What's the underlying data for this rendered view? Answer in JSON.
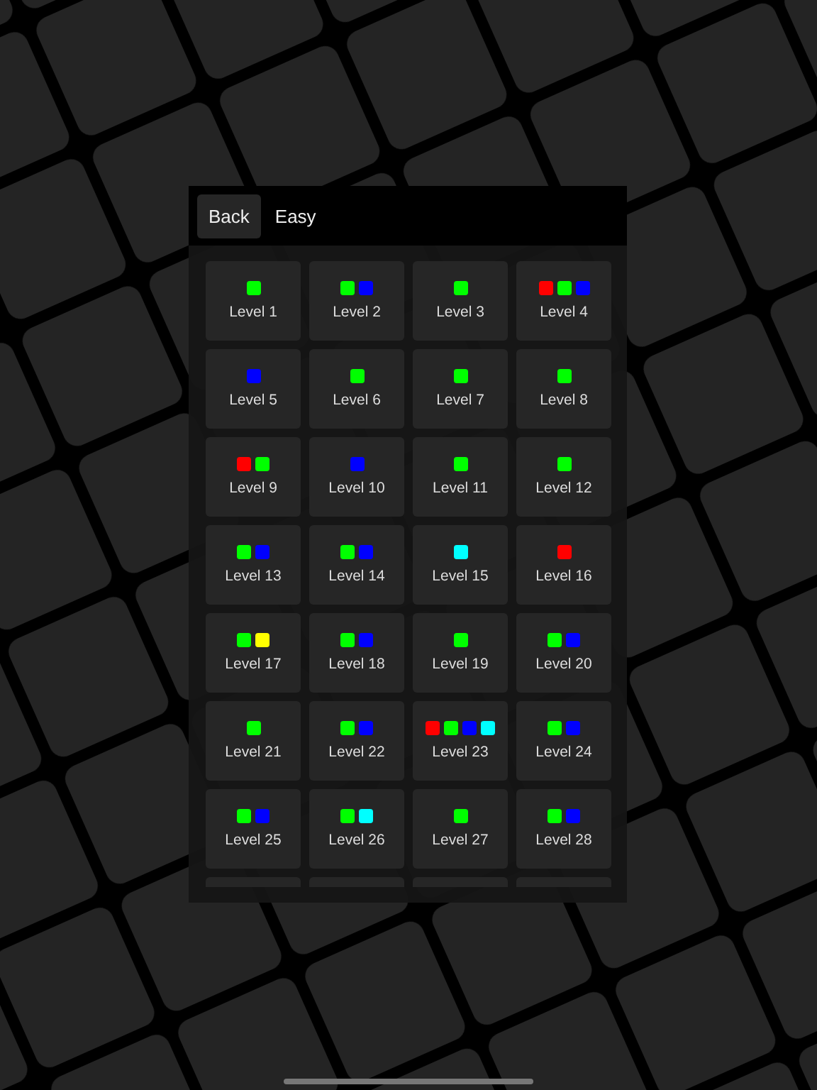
{
  "header": {
    "back_button": "Back",
    "title": "Easy"
  },
  "levels": [
    {
      "label": "Level 1",
      "dots": [
        {
          "color": "#00ff00"
        }
      ]
    },
    {
      "label": "Level 2",
      "dots": [
        {
          "color": "#00ff00"
        },
        {
          "color": "#0000ff"
        }
      ]
    },
    {
      "label": "Level 3",
      "dots": [
        {
          "color": "#00ff00"
        }
      ]
    },
    {
      "label": "Level 4",
      "dots": [
        {
          "color": "#ff0000"
        },
        {
          "color": "#00ff00"
        },
        {
          "color": "#0000ff"
        }
      ]
    },
    {
      "label": "Level 5",
      "dots": [
        {
          "color": "#0000ff"
        }
      ]
    },
    {
      "label": "Level 6",
      "dots": [
        {
          "color": "#00ff00"
        }
      ]
    },
    {
      "label": "Level 7",
      "dots": [
        {
          "color": "#00ff00"
        }
      ]
    },
    {
      "label": "Level 8",
      "dots": [
        {
          "color": "#00ff00"
        }
      ]
    },
    {
      "label": "Level 9",
      "dots": [
        {
          "color": "#ff0000"
        },
        {
          "color": "#00ff00"
        }
      ]
    },
    {
      "label": "Level 10",
      "dots": [
        {
          "color": "#0000ff"
        }
      ]
    },
    {
      "label": "Level 11",
      "dots": [
        {
          "color": "#00ff00"
        }
      ]
    },
    {
      "label": "Level 12",
      "dots": [
        {
          "color": "#00ff00"
        }
      ]
    },
    {
      "label": "Level 13",
      "dots": [
        {
          "color": "#00ff00"
        },
        {
          "color": "#0000ff"
        }
      ]
    },
    {
      "label": "Level 14",
      "dots": [
        {
          "color": "#00ff00"
        },
        {
          "color": "#0000ff"
        }
      ]
    },
    {
      "label": "Level 15",
      "dots": [
        {
          "color": "#00ffff"
        }
      ]
    },
    {
      "label": "Level 16",
      "dots": [
        {
          "color": "#ff0000"
        }
      ]
    },
    {
      "label": "Level 17",
      "dots": [
        {
          "color": "#00ff00"
        },
        {
          "color": "#ffff00"
        }
      ]
    },
    {
      "label": "Level 18",
      "dots": [
        {
          "color": "#00ff00"
        },
        {
          "color": "#0000ff"
        }
      ]
    },
    {
      "label": "Level 19",
      "dots": [
        {
          "color": "#00ff00"
        }
      ]
    },
    {
      "label": "Level 20",
      "dots": [
        {
          "color": "#00ff00"
        },
        {
          "color": "#0000ff"
        }
      ]
    },
    {
      "label": "Level 21",
      "dots": [
        {
          "color": "#00ff00"
        }
      ]
    },
    {
      "label": "Level 22",
      "dots": [
        {
          "color": "#00ff00"
        },
        {
          "color": "#0000ff"
        }
      ]
    },
    {
      "label": "Level 23",
      "dots": [
        {
          "color": "#ff0000"
        },
        {
          "color": "#00ff00"
        },
        {
          "color": "#0000ff"
        },
        {
          "color": "#00ffff"
        }
      ]
    },
    {
      "label": "Level 24",
      "dots": [
        {
          "color": "#00ff00"
        },
        {
          "color": "#0000ff"
        }
      ]
    },
    {
      "label": "Level 25",
      "dots": [
        {
          "color": "#00ff00"
        },
        {
          "color": "#0000ff"
        }
      ]
    },
    {
      "label": "Level 26",
      "dots": [
        {
          "color": "#00ff00"
        },
        {
          "color": "#00ffff"
        }
      ]
    },
    {
      "label": "Level 27",
      "dots": [
        {
          "color": "#00ff00"
        }
      ]
    },
    {
      "label": "Level 28",
      "dots": [
        {
          "color": "#00ff00"
        },
        {
          "color": "#0000ff"
        }
      ]
    }
  ]
}
